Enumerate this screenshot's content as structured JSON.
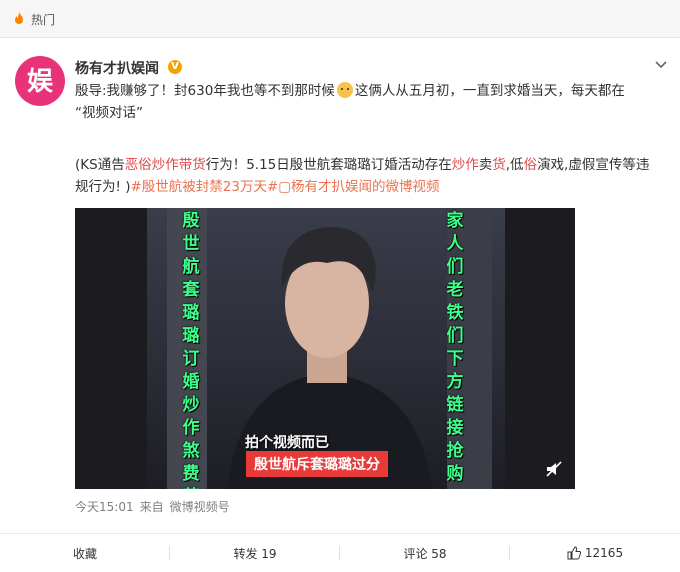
{
  "topbar": {
    "label": "热门",
    "icon": "hot-flame-icon"
  },
  "post": {
    "author": "杨有才扒娱闻",
    "verified_badge": "V",
    "avatar_text": "娱",
    "line1_a": "殷导:我赚够了！封630年我也等不到那时候",
    "line1_b": "这俩人从五月初，一直到求婚当天，每天都在",
    "line1_c": "“视频对话”",
    "para2_a": "(KS通告",
    "para2_red1": "恶俗炒作带货",
    "para2_b": "行为！5.15日殷世航套璐璐订婚活动存在",
    "para2_red2": "炒作",
    "para2_c": "卖",
    "para2_red3": "货",
    "para2_d": ",低",
    "para2_red4": "俗",
    "para2_e": "演戏,虚假宣传等违",
    "para2_f": "规行为! )",
    "hashtag": "#殷世航被封禁23万天#",
    "video_link": "▢杨有才扒娱闻的微博视频",
    "video": {
      "caption_left": "殷世航套璐璐订婚炒作煞费苦心",
      "caption_right": "家人们老铁们下方链接抢购一空",
      "subtitle_1": "拍个视频而已",
      "subtitle_2": "殷世航斥套璐璐过分"
    },
    "time": "今天15:01",
    "source_prefix": "来自",
    "source": "微博视频号"
  },
  "actions": {
    "favorite": "收藏",
    "repost": "转发 19",
    "comment": "评论 58",
    "like": "12165"
  },
  "colors": {
    "accent": "#eb7350",
    "red": "#e0494b",
    "caption_green": "#3cff8c",
    "brand_pink": "#e8337b"
  }
}
